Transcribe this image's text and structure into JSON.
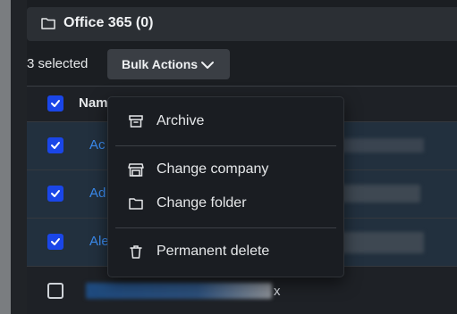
{
  "folder": {
    "title": "Office 365 (0)",
    "icon": "folder-icon"
  },
  "toolbar": {
    "selected_text": "3 selected",
    "bulk_actions_label": "Bulk Actions"
  },
  "table": {
    "header_name": "Nam",
    "rows": [
      {
        "name": "Ac",
        "checked": true
      },
      {
        "name": "Ad",
        "checked": true
      },
      {
        "name": "Ale",
        "checked": true
      },
      {
        "name": "x",
        "checked": false
      }
    ]
  },
  "menu": {
    "items": [
      {
        "label": "Archive",
        "icon": "archive-icon"
      },
      {
        "label": "Change company",
        "icon": "store-icon"
      },
      {
        "label": "Change folder",
        "icon": "folder-icon"
      },
      {
        "label": "Permanent delete",
        "icon": "trash-icon"
      }
    ]
  },
  "colors": {
    "accent": "#1a46e8",
    "link": "#3b8cf0",
    "selected_row": "#22303e"
  }
}
